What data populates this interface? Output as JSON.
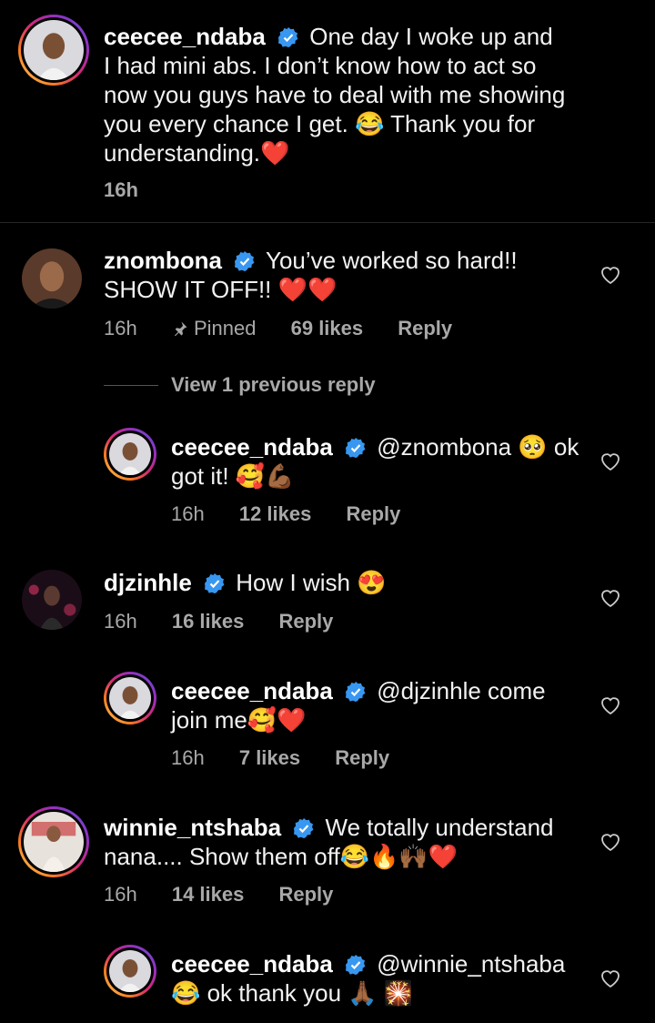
{
  "caption": {
    "username": "ceecee_ndaba",
    "text_lines": [
      "One day I woke up and",
      "I had mini abs. I don’t know how to act so",
      "now you guys have to deal with me showing",
      "you every chance I get. 😂 Thank you for",
      "understanding.❤️"
    ],
    "time": "16h"
  },
  "comments": [
    {
      "username": "znombona",
      "line1": "You’ve worked so hard!!",
      "line2": "SHOW IT OFF!! ❤️❤️",
      "time": "16h",
      "pinned": "Pinned",
      "likes": "69 likes",
      "reply": "Reply"
    },
    {
      "view_replies": "View 1 previous reply"
    },
    {
      "username": "ceecee_ndaba",
      "line1": "@znombona 🥺 ok",
      "line2": "got it! 🥰💪🏾",
      "time": "16h",
      "likes": "12 likes",
      "reply": "Reply"
    },
    {
      "username": "djzinhle",
      "line1": "How I wish 😍",
      "time": "16h",
      "likes": "16 likes",
      "reply": "Reply"
    },
    {
      "username": "ceecee_ndaba",
      "line1": "@djzinhle come",
      "line2": "join me🥰❤️",
      "time": "16h",
      "likes": "7 likes",
      "reply": "Reply"
    },
    {
      "username": "winnie_ntshaba",
      "line1": "We totally understand",
      "line2": "nana.... Show them off😂🔥🙌🏾❤️",
      "time": "16h",
      "likes": "14 likes",
      "reply": "Reply"
    },
    {
      "username": "ceecee_ndaba",
      "line1": "@winnie_ntshaba",
      "line2": "😂 ok thank you 🙏🏾 🎇"
    }
  ],
  "colors": {
    "background": "#000000",
    "verified": "#3897f0",
    "meta": "#a8a8a8"
  }
}
